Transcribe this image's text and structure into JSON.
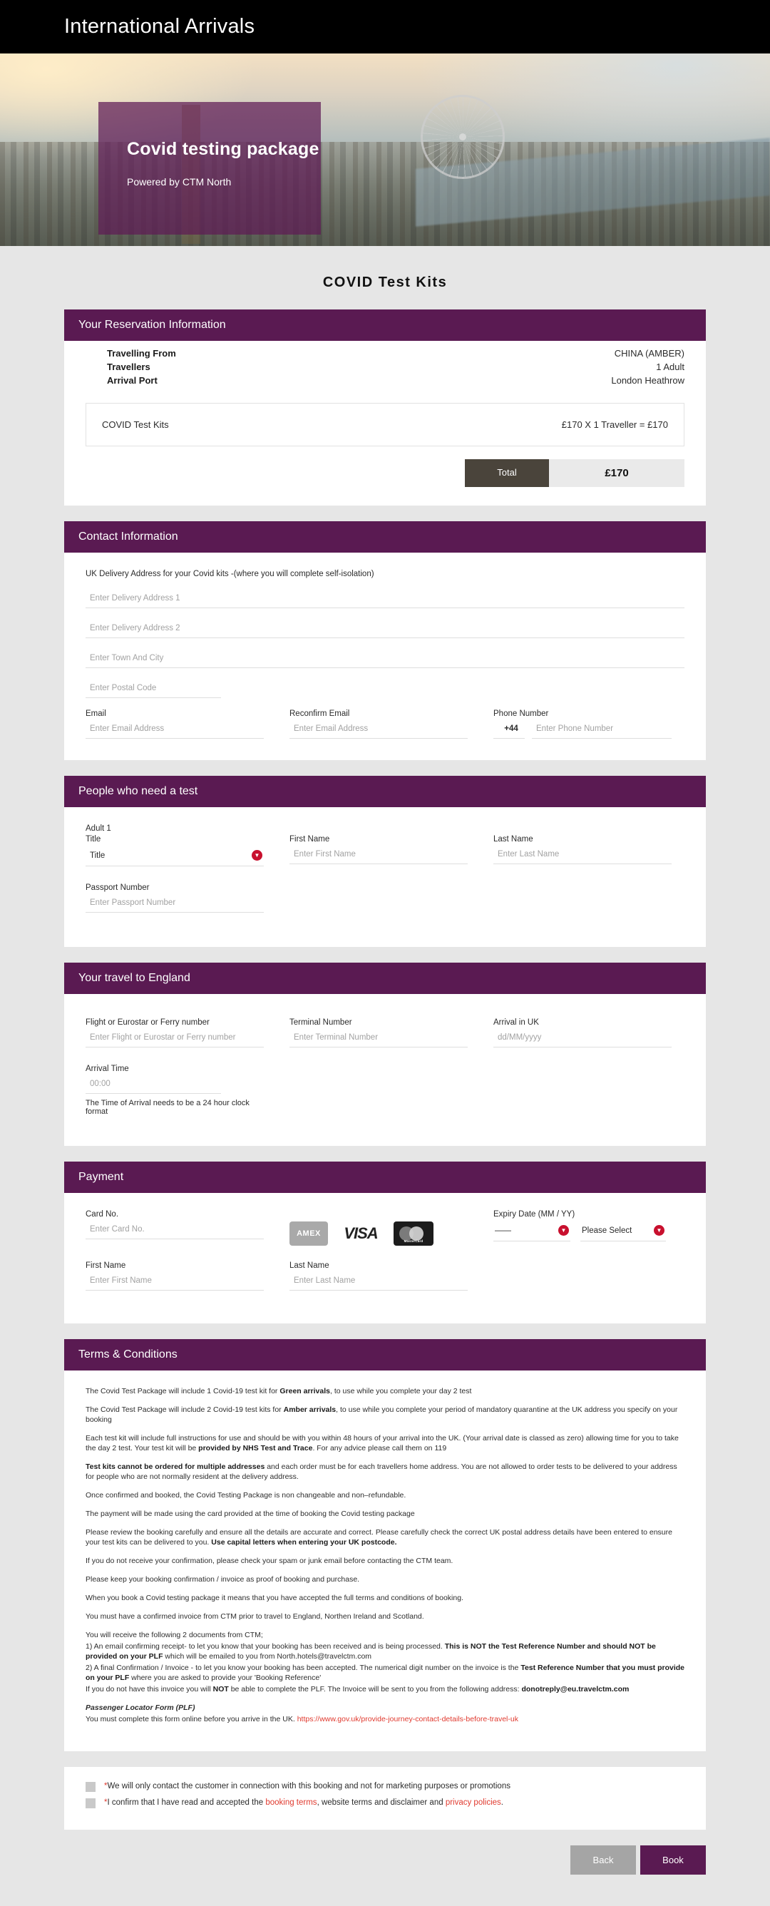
{
  "header": {
    "title": "International Arrivals"
  },
  "hero": {
    "heading": "Covid testing package",
    "subheading": "Powered by CTM North",
    "overlay_color": "#5e1a54"
  },
  "page_title": "COVID Test Kits",
  "theme": {
    "accent_purple": "#5a1a52",
    "page_bg": "#e6e6e6",
    "total_label_bg": "#4a443b",
    "link_red": "#e03a2f",
    "caret_red": "#c8102e"
  },
  "reservation": {
    "section_title": "Your Reservation Information",
    "rows": [
      {
        "label": "Travelling From",
        "value": "CHINA (AMBER)"
      },
      {
        "label": "Travellers",
        "value": "1 Adult"
      },
      {
        "label": "Arrival Port",
        "value": "London Heathrow"
      }
    ],
    "item_name": "COVID Test Kits",
    "item_price": "£170 X 1 Traveller = £170",
    "total_label": "Total",
    "total_value": "£170"
  },
  "contact": {
    "section_title": "Contact Information",
    "note": "UK Delivery Address for your Covid kits -(where you will complete self-isolation)",
    "address1_placeholder": "Enter Delivery Address 1",
    "address2_placeholder": "Enter Delivery Address 2",
    "city_placeholder": "Enter Town And City",
    "postal_placeholder": "Enter Postal Code",
    "email_label": "Email",
    "email_placeholder": "Enter Email Address",
    "reconfirm_label": "Reconfirm Email",
    "reconfirm_placeholder": "Enter Email Address",
    "phone_label": "Phone Number",
    "phone_country_code": "+44",
    "phone_placeholder": "Enter Phone Number"
  },
  "people": {
    "section_title": "People who need a test",
    "adult_label": "Adult 1",
    "title_label": "Title",
    "title_value": "Title",
    "first_name_label": "First Name",
    "first_name_placeholder": "Enter First Name",
    "last_name_label": "Last Name",
    "last_name_placeholder": "Enter Last Name",
    "passport_label": "Passport Number",
    "passport_placeholder": "Enter Passport Number"
  },
  "travel": {
    "section_title": "Your travel to England",
    "flight_label": "Flight or Eurostar or Ferry number",
    "flight_placeholder": "Enter Flight or Eurostar or Ferry number",
    "terminal_label": "Terminal Number",
    "terminal_placeholder": "Enter Terminal Number",
    "arrival_label": "Arrival in UK",
    "arrival_placeholder": "dd/MM/yyyy",
    "arrival_time_label": "Arrival Time",
    "arrival_time_placeholder": "00:00",
    "arrival_time_hint": "The Time of Arrival needs to be a 24 hour clock format"
  },
  "payment": {
    "section_title": "Payment",
    "card_label": "Card No.",
    "card_placeholder": "Enter Card No.",
    "logos": [
      {
        "name": "amex-card-logo",
        "text": "AMEX"
      },
      {
        "name": "visa-card-logo",
        "text": "VISA"
      },
      {
        "name": "mastercard-card-logo",
        "text": "MasterCard"
      }
    ],
    "expiry_label": "Expiry Date (MM / YY)",
    "expiry_month_value": "——",
    "expiry_year_value": "Please Select",
    "first_name_label": "First Name",
    "first_name_placeholder": "Enter First Name",
    "last_name_label": "Last Name",
    "last_name_placeholder": "Enter Last Name"
  },
  "terms": {
    "section_title": "Terms & Conditions",
    "paragraphs": [
      "The Covid Test Package will include 1 Covid-19 test kit for Green arrivals, to use while you complete your day 2 test",
      "The Covid Test Package will include 2 Covid-19 test kits for Amber arrivals, to use while you complete your period of mandatory quarantine at the UK address you specify on your booking",
      "Each test kit will include full instructions for use and should be with you within 48 hours of your arrival into the UK. (Your arrival date is classed as zero) allowing time for you to take the day 2 test. Your test kit will be provided by NHS Test and Trace. For any advice please call them on 119",
      "Test kits cannot be ordered for multiple addresses and each order must be for each travellers home address. You are not allowed to order tests to be delivered to your address for people who are not normally resident at the delivery address.",
      "Once confirmed and booked, the Covid Testing Package is non changeable and non–refundable.",
      "The payment will be made using the card provided at the time of booking the Covid testing package",
      "Please review the booking carefully and ensure all the details are accurate and correct. Please carefully check the correct UK postal address details have been entered to ensure your test kits can be delivered to you. Use capital letters when entering your UK postcode.",
      "If you do not receive your confirmation, please check your spam or junk email before contacting the CTM team.",
      "Please keep your booking confirmation / invoice as proof of booking and purchase.",
      "When you book a Covid testing package it means that you have accepted the full terms and conditions of booking.",
      "You must have a confirmed invoice from CTM prior to travel to England, Northen Ireland and Scotland."
    ],
    "docs_intro": "You will receive the following 2 documents from CTM;",
    "doc1_a": "1) An email confirming receipt- to let you know that your booking has been received and is being processed. ",
    "doc1_bold": "This is NOT the Test Reference Number and should NOT be provided on your PLF",
    "doc1_b": " which will be emailed to you from North.hotels@travelctm.com",
    "doc2_a": "2) A final Confirmation / Invoice - to let you know your booking has been accepted. The numerical digit number on the invoice is the ",
    "doc2_bold": "Test Reference Number that you must provide on your PLF",
    "doc2_b": " where you are asked to provide your 'Booking Reference'",
    "doc3_a": "If you do not have this invoice you will ",
    "doc3_bold1": "NOT",
    "doc3_b": " be able to complete the PLF. The Invoice will be sent to you from the following address: ",
    "doc3_bold2": "donotreply@eu.travelctm.com",
    "plf_title": "Passenger Locator Form (PLF)",
    "plf_text": "You must complete this form online before you arrive in the UK. ",
    "plf_link": "https://www.gov.uk/provide-journey-contact-details-before-travel-uk"
  },
  "consent": {
    "line1_prefix": "*",
    "line1": "We will only contact the customer in connection with this booking and not for marketing purposes or promotions",
    "line2_prefix": "*",
    "line2_a": "I confirm that I have read and accepted the ",
    "line2_link1": "booking terms",
    "line2_b": ", website terms and disclaimer and ",
    "line2_link2": "privacy policies",
    "line2_c": "."
  },
  "footer": {
    "back_label": "Back",
    "book_label": "Book"
  }
}
